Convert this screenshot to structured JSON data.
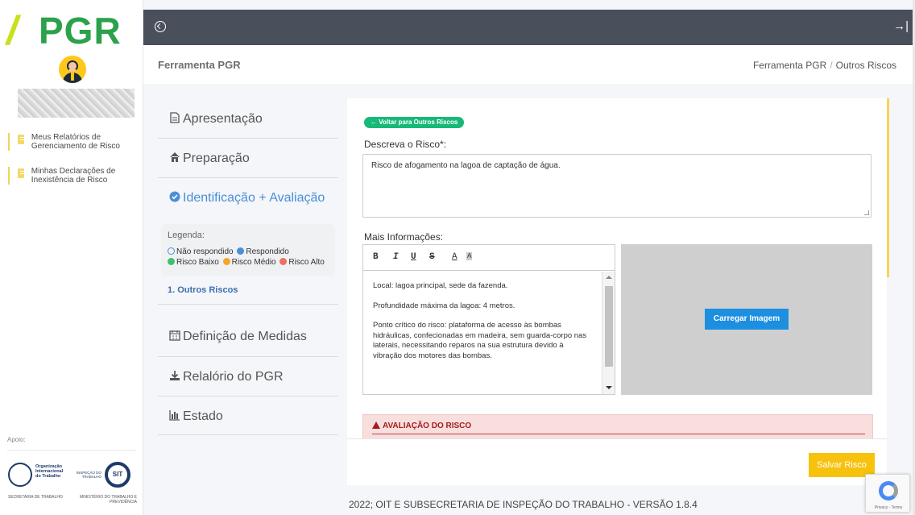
{
  "app": {
    "logo_text": "PGR",
    "logo_slash": "//",
    "page_title": "Ferramenta PGR",
    "breadcrumb": [
      "Ferramenta PGR",
      "Outros Riscos"
    ]
  },
  "sidebar": {
    "links": [
      {
        "label": "Meus Relatórios de Gerenciamento de Risco"
      },
      {
        "label": "Minhas Declarações de Inexistência de Risco"
      }
    ],
    "apoio_label": "Apoio:",
    "oit_text": "Organização Internacional do Trabalho",
    "inspecao_text": "INSPEÇÃO DO TRABALHO",
    "sit_text": "SIT",
    "gov_left": "SECRETARIA DE TRABALHO",
    "gov_right": "MINISTÉRIO DO TRABALHO E PREVIDÊNCIA"
  },
  "steps": [
    {
      "label": "Apresentação",
      "icon": "file-icon"
    },
    {
      "label": "Preparação",
      "icon": "home-icon"
    },
    {
      "label": "Identificação + Avaliação",
      "icon": "check-circle-icon"
    },
    {
      "label": "Definição de Medidas",
      "icon": "calendar-icon"
    },
    {
      "label": "Relalório do PGR",
      "icon": "download-icon"
    },
    {
      "label": "Estado",
      "icon": "bar-chart-icon"
    }
  ],
  "legend": {
    "title": "Legenda:",
    "row1": [
      "Não respondido",
      "Respondido"
    ],
    "row2": [
      "Risco Baixo",
      "Risco Médio",
      "Risco Alto"
    ]
  },
  "sub_step": "1. Outros Riscos",
  "form": {
    "back_label": "← Voltar para Outros Riscos",
    "desc_label": "Descreva o Risco*:",
    "desc_value": "Risco de afogamento na lagoa de captação de água.",
    "mais_label": "Mais Informações:",
    "toolbar": [
      "B",
      "I",
      "U",
      "S",
      "A",
      "A"
    ],
    "mais_paragraphs": [
      "Local: lagoa principal, sede da fazenda.",
      "Profundidade máxima da lagoa: 4 metros.",
      "Ponto crítico do risco: plataforma de acesso às bombas hidráulicas, confecionadas em madeira, sem guarda-corpo nas laterais, necessitando reparos na sua estrutura devido à vibração dos motores das bombas."
    ],
    "upload_label": "Carregar Imagem",
    "aval_title": "AVALIAÇÃO DO RISCO",
    "save_label": "Salvar Risco"
  },
  "footer": "2022; OIT E SUBSECRETARIA DE INSPEÇÃO DO TRABALHO - VERSÃO 1.8.4",
  "recaptcha_text": "Privacy - Terms",
  "colors": {
    "accent_green": "#17b978",
    "save_yellow": "#f7c20e",
    "upload_blue": "#1d8fe0",
    "topbar": "#4a4f5c",
    "active_step": "#4a8fd6"
  }
}
